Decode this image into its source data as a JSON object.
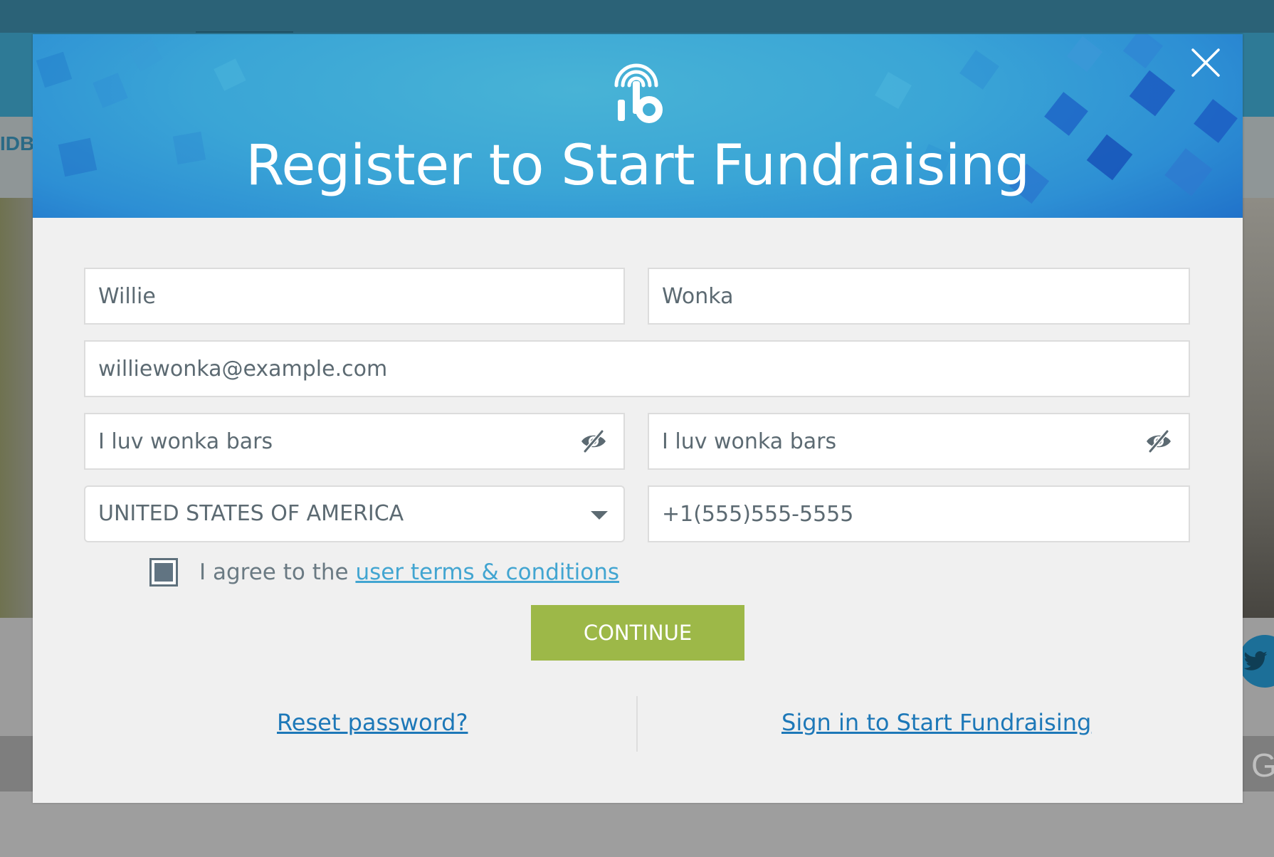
{
  "background": {
    "nav_fragment": "IDB",
    "footer_fragment": "G"
  },
  "modal": {
    "title": "Register to Start Fundraising",
    "logo_icon": "ib-fingerprint-logo-icon",
    "close_icon": "close-x-icon"
  },
  "form": {
    "first_name": {
      "value": "Willie"
    },
    "last_name": {
      "value": "Wonka"
    },
    "email": {
      "value": "williewonka@example.com"
    },
    "password": {
      "value": "I luv wonka bars",
      "icon": "eye-slash-icon"
    },
    "confirm_password": {
      "value": "I luv wonka bars",
      "icon": "eye-slash-icon"
    },
    "country": {
      "selected": "UNITED STATES OF AMERICA",
      "icon": "caret-down-icon"
    },
    "phone": {
      "value": "+1(555)555-5555"
    },
    "agree": {
      "checked": true,
      "prefix": "I agree to the ",
      "link_text": "user terms & conditions"
    },
    "continue_label": "CONTINUE"
  },
  "links": {
    "reset_password": "Reset password?",
    "sign_in": "Sign in to Start Fundraising"
  },
  "colors": {
    "header_blue": "#3aa5d6",
    "continue_green": "#9db848",
    "link_blue": "#1d78b8",
    "terms_link": "#42a5d1",
    "modal_bg": "#f0f0f0"
  }
}
